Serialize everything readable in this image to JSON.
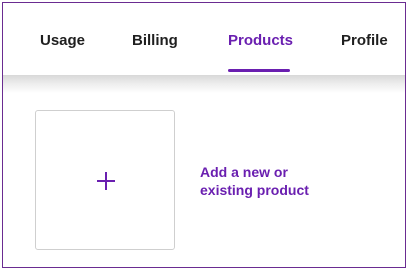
{
  "tabs": [
    {
      "label": "Usage",
      "active": false
    },
    {
      "label": "Billing",
      "active": false
    },
    {
      "label": "Products",
      "active": true
    },
    {
      "label": "Profile",
      "active": false
    }
  ],
  "add_product": {
    "icon": "plus-icon",
    "label_line1": "Add a new or",
    "label_line2": "existing product"
  },
  "colors": {
    "accent": "#6a1fb0",
    "border": "#6a2c91",
    "text": "#1f1f1f",
    "card_border": "#cfcfcf"
  }
}
